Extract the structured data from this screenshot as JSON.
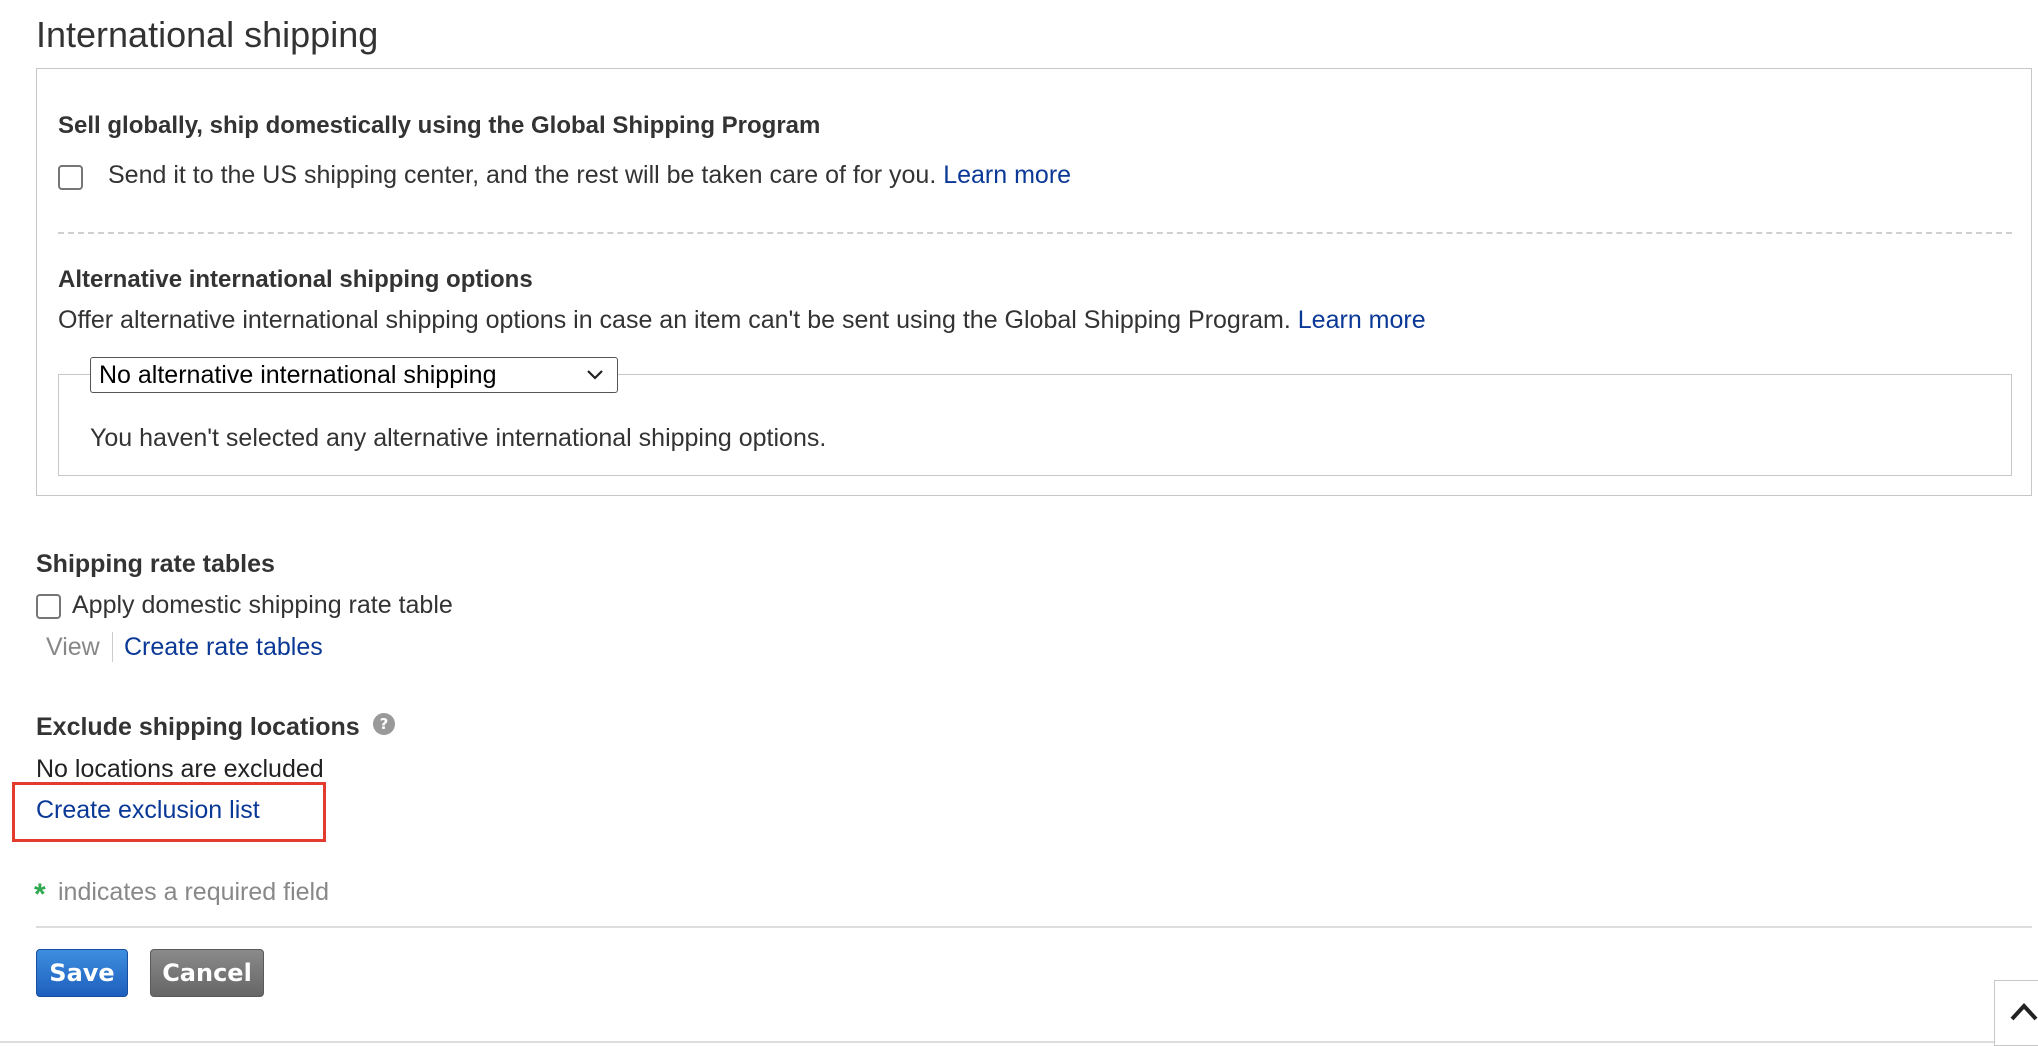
{
  "section_title": "International shipping",
  "global_shipping": {
    "heading": "Sell globally, ship domestically using the Global Shipping Program",
    "checkbox_label": "Send it to the US shipping center, and the rest will be taken care of for you.",
    "learn_more": "Learn more"
  },
  "alternative": {
    "heading": "Alternative international shipping options",
    "description": "Offer alternative international shipping options in case an item can't be sent using the Global Shipping Program.",
    "learn_more": "Learn more",
    "select_value": "No alternative international shipping",
    "empty_message": "You haven't selected any alternative international shipping options."
  },
  "rate_tables": {
    "heading": "Shipping rate tables",
    "checkbox_label": "Apply domestic shipping rate table",
    "view": "View",
    "create": "Create rate tables"
  },
  "exclusions": {
    "heading": "Exclude shipping locations",
    "status": "No locations are excluded",
    "create": "Create exclusion list"
  },
  "required_note": {
    "marker": "*",
    "text": "indicates a required field"
  },
  "buttons": {
    "save": "Save",
    "cancel": "Cancel"
  },
  "colors": {
    "link": "#0a3896",
    "highlight": "#e33b2e",
    "required_marker": "#2fa84f",
    "save_button": "#1e5fbd",
    "cancel_button": "#666666"
  }
}
